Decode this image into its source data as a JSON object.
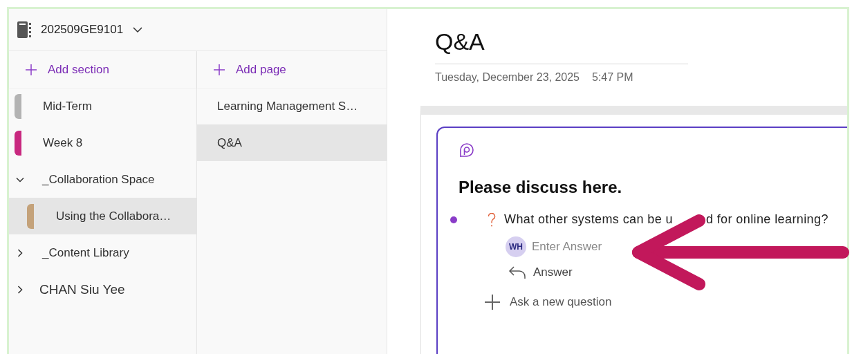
{
  "notebook": {
    "name": "202509GE9101"
  },
  "sections": {
    "add_label": "Add section",
    "items": [
      {
        "kind": "section",
        "label": "Mid-Term",
        "color": "#b3b3b3",
        "selected": false
      },
      {
        "kind": "section",
        "label": "Week 8",
        "color": "#c8287f",
        "selected": false
      },
      {
        "kind": "group",
        "label": "_Collaboration Space",
        "expanded": true,
        "children": [
          {
            "kind": "section",
            "label": "Using the Collabora…",
            "color": "#c4a27a",
            "selected": true
          }
        ]
      },
      {
        "kind": "group",
        "label": "_Content Library",
        "expanded": false
      },
      {
        "kind": "user_group",
        "label": "CHAN Siu Yee",
        "expanded": false
      }
    ]
  },
  "pages": {
    "add_label": "Add page",
    "items": [
      {
        "label": "Learning Management S…",
        "selected": false
      },
      {
        "label": "Q&A",
        "selected": true
      }
    ]
  },
  "page": {
    "title": "Q&A",
    "date": "Tuesday, December 23, 2025",
    "time": "5:47 PM",
    "qa": {
      "heading": "Please discuss here.",
      "questions": [
        {
          "unread": true,
          "text_before": "What other systems can be u",
          "text_after": "d for online learning?",
          "avatar_initials": "WH",
          "answer_placeholder": "Enter Answer",
          "reply_label": "Answer"
        }
      ],
      "ask_label": "Ask a new question"
    }
  }
}
